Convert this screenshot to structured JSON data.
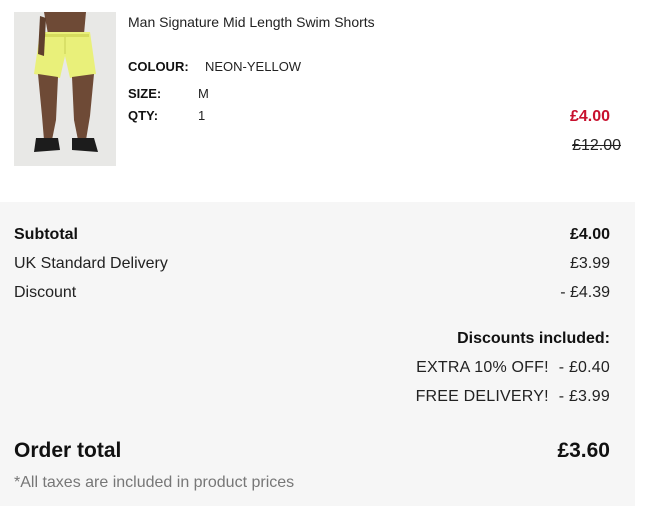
{
  "product": {
    "name": "Man Signature Mid Length Swim Shorts",
    "image_alt": "model wearing neon-yellow swim shorts",
    "colour_label": "COLOUR:",
    "colour_value": "NEON-YELLOW",
    "size_label": "SIZE:",
    "size_value": "M",
    "qty_label": "QTY:",
    "qty_value": "1",
    "price_now": "£4.00",
    "price_was": "£12.00",
    "sale_color": "#c8102e"
  },
  "summary": {
    "subtotal_label": "Subtotal",
    "subtotal_value": "£4.00",
    "delivery_label": "UK Standard Delivery",
    "delivery_value": "£3.99",
    "discount_label": "Discount",
    "discount_value": "- £4.39",
    "discounts_included_label": "Discounts included:",
    "discounts": [
      {
        "name": "EXTRA 10% OFF!",
        "amount": "- £0.40"
      },
      {
        "name": "FREE DELIVERY!",
        "amount": "- £3.99"
      }
    ],
    "order_total_label": "Order total",
    "order_total_value": "£3.60",
    "tax_note": "*All taxes are included in product prices"
  }
}
